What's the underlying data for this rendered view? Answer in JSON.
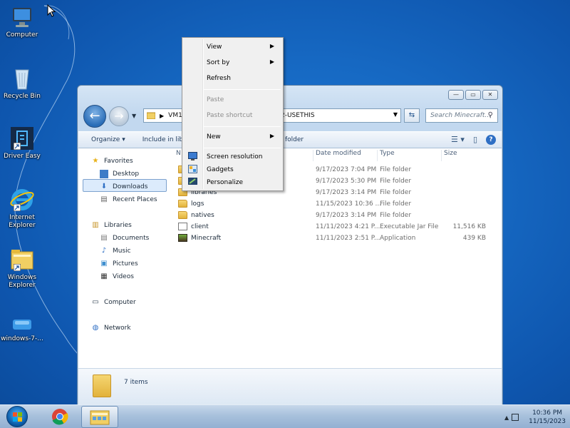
{
  "desktop": {
    "icons": [
      {
        "label": "Computer"
      },
      {
        "label": "Recycle Bin"
      },
      {
        "label": "Driver Easy"
      },
      {
        "label": "Internet Explorer"
      },
      {
        "label": "Windows Explorer"
      },
      {
        "label": "windows-7-..."
      }
    ]
  },
  "explorer": {
    "address_crumb_start": "VM1",
    "address_crumb_end": "2-USETHIS",
    "search_placeholder": "Search Minecraft...",
    "toolbar": {
      "organize": "Organize",
      "include_in_library": "Include in libra",
      "folder_suffix": "folder"
    },
    "nav_pane": {
      "favorites": "Favorites",
      "desktop": "Desktop",
      "downloads": "Downloads",
      "recent_places": "Recent Places",
      "libraries": "Libraries",
      "documents": "Documents",
      "music": "Music",
      "pictures": "Pictures",
      "videos": "Videos",
      "computer": "Computer",
      "network": "Network"
    },
    "columns": {
      "name": "N",
      "date_modified": "Date modified",
      "type": "Type",
      "size": "Size"
    },
    "files": [
      {
        "name": "",
        "date": "9/17/2023 7:04 PM",
        "type": "File folder",
        "size": ""
      },
      {
        "name": "",
        "date": "9/17/2023 5:30 PM",
        "type": "File folder",
        "size": ""
      },
      {
        "name": "libraries",
        "date": "9/17/2023 3:14 PM",
        "type": "File folder",
        "size": ""
      },
      {
        "name": "logs",
        "date": "11/15/2023 10:36 ...",
        "type": "File folder",
        "size": ""
      },
      {
        "name": "natives",
        "date": "9/17/2023 3:14 PM",
        "type": "File folder",
        "size": ""
      },
      {
        "name": "client",
        "date": "11/11/2023 4:21 P...",
        "type": "Executable Jar File",
        "size": "11,516 KB"
      },
      {
        "name": "Minecraft",
        "date": "11/11/2023 2:51 P...",
        "type": "Application",
        "size": "439 KB"
      }
    ],
    "status": {
      "item_count": "7 items"
    }
  },
  "context_menu": {
    "view": "View",
    "sort_by": "Sort by",
    "refresh": "Refresh",
    "paste": "Paste",
    "paste_shortcut": "Paste shortcut",
    "new": "New",
    "screen_resolution": "Screen resolution",
    "gadgets": "Gadgets",
    "personalize": "Personalize"
  },
  "taskbar": {
    "time": "10:36 PM",
    "date": "11/15/2023"
  },
  "colors": {
    "desktop_blue": "#1668c2",
    "selection": "#dcebfc",
    "folder": "#e2b33c"
  }
}
